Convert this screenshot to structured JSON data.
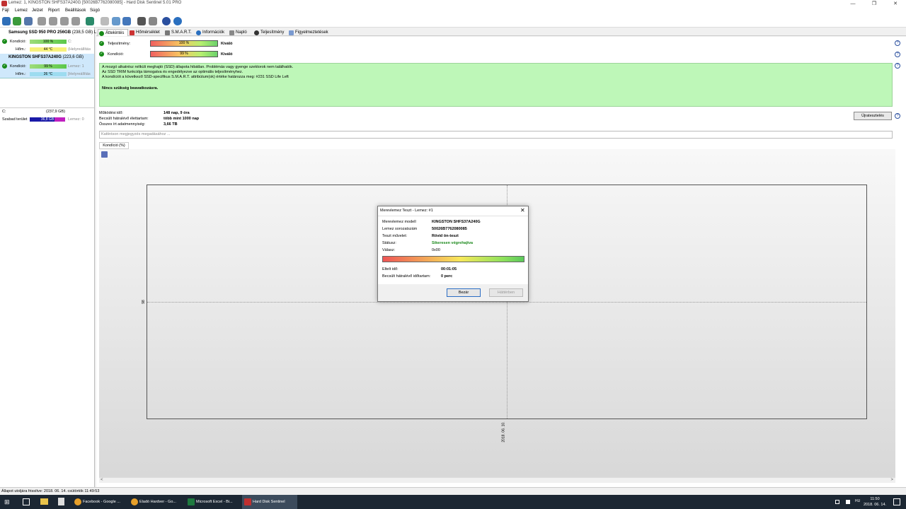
{
  "window": {
    "title": "Lemez: 1, KINGSTON SHFS37A240G [50026B7762080085]  -  Hard Disk Sentinel 5.01 PRO"
  },
  "menu": [
    "Fájl",
    "Lemez",
    "Jelzet",
    "Riport",
    "Beállítások",
    "Súgó"
  ],
  "disks": [
    {
      "name": "Samsung SSD 950 PRO 256GB",
      "size": "(238,5 GB)",
      "extra": "Le",
      "kondicio_label": "Kondíció:",
      "kondicio": "100 %",
      "kondicio_extra": "C:",
      "hom_label": "Hőm.:",
      "hom": "44 °C",
      "hom_extra": "(Helyreállítás"
    },
    {
      "name": "KINGSTON SHFS37A240G",
      "size": "(223,6 GB)",
      "kondicio_label": "Kondíció:",
      "kondicio": "99 %",
      "kondicio_extra": "Lemez: 1",
      "hom_label": "Hőm.:",
      "hom": "26 °C",
      "hom_extra": "[Helyreállítás"
    }
  ],
  "volume": {
    "drive": "C:",
    "size": "(237,9 GB)",
    "free_label": "Szabad terület",
    "free": "36,8 GB",
    "disk_ref": "Lemez: 0"
  },
  "tabs": [
    "Áttekintés",
    "Hőmérséklet",
    "S.M.A.R.T.",
    "Információk",
    "Napló",
    "Teljesítmény",
    "Figyelmeztetések"
  ],
  "overview": {
    "teljesitmeny_label": "Teljesítmény:",
    "teljesitmeny_value": "100 %",
    "teljesitmeny_text": "Kiváló",
    "kondicio_label": "Kondíció:",
    "kondicio_value": "99 %",
    "kondicio_text": "Kiváló",
    "teljesitmeny_fraction": 1.0,
    "kondicio_fraction": 0.99
  },
  "message": {
    "line1": "A mozgó alkatrész nélküli meghajtó (SSD) állapota hibátlan. Problémás vagy gyenge szektorok nem találhatók.",
    "line2": "Az SSD TRIM funkciója támogatva és engedélyezve az optimális teljesítményhez.",
    "line3": "A kondíciót a következő SSD-specifikus S.M.A.R.T. attribútum(ok) értéke határozza meg:  #231 SSD Life Left",
    "line4": "Nincs szükség beavatkozásra."
  },
  "stats": {
    "mukodesi_label": "Működési idő:",
    "mukodesi_value": "148 nap, 9 óra",
    "elettartam_label": "Becsült hátralévő élettartam:",
    "elettartam_value": "több mint 1000 nap",
    "adat_label": "Összes írt adatmennyiség:",
    "adat_value": "3,66 TB",
    "ujrateszt_button": "Újratesztelés"
  },
  "comment_placeholder": "Kattintson megjegyzés megadásához ...",
  "subtab": "Kondíció  (%)",
  "chart": {
    "y_tick": "98",
    "x_tick": "2018. 06. 10."
  },
  "dialog": {
    "title": "Merevlemez Teszt - Lemez: #1",
    "model_label": "Merevlemez modell",
    "model_value": "KINGSTON SHFS37A240G",
    "serial_label": "Lemez sorozatszám",
    "serial_value": "50026B7762080085",
    "op_label": "Teszt művelet:",
    "op_value": "Rövid ön-teszt",
    "status_label": "Státusz:",
    "status_value": "Sikeresen végrehajtva",
    "answer_label": "Válasz:",
    "answer_value": "0x00",
    "elapsed_label": "Eltelt idő:",
    "elapsed_value": "00:01:05",
    "remaining_label": "Becsült hátralévő időtartam:",
    "remaining_value": "0 perc",
    "close_button": "Bezár",
    "background_button": "Háttérben"
  },
  "statusbar": "Állapot utoljára frissítve: 2018. 06. 14. csütörtök 11:49:53",
  "taskbar": {
    "items": [
      "Facebook - Google ...",
      "Eladó Hardver - Go...",
      "Microsoft Excel - Bi...",
      "Hard Disk Sentinel"
    ],
    "time": "11:50",
    "date": "2018. 06. 14."
  }
}
